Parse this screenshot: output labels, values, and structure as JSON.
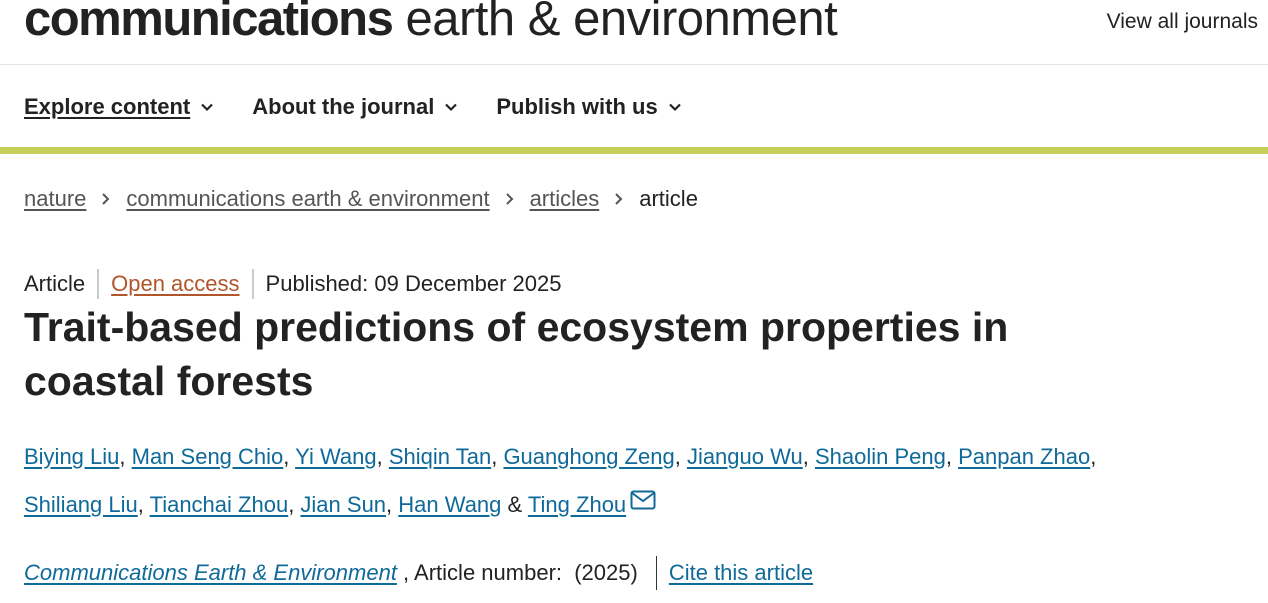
{
  "header": {
    "brand_bold": "communications",
    "brand_light": " earth & environment",
    "view_all": "View all journals"
  },
  "nav": {
    "items": [
      {
        "label": "Explore content"
      },
      {
        "label": "About the journal"
      },
      {
        "label": "Publish with us"
      }
    ]
  },
  "colors": {
    "accent_bar": "#c7cf5b",
    "link_blue": "#0f6a9a",
    "open_access": "#b1562b"
  },
  "breadcrumb": {
    "items": [
      "nature",
      "communications earth & environment",
      "articles"
    ],
    "current": "article"
  },
  "meta": {
    "type": "Article",
    "access": "Open access",
    "published": "Published: 09 December 2025"
  },
  "article": {
    "title": "Trait-based predictions of ecosystem properties in coastal forests"
  },
  "authors": {
    "names": [
      "Biying Liu",
      "Man Seng Chio",
      "Yi Wang",
      "Shiqin Tan",
      "Guanghong Zeng",
      "Jianguo Wu",
      "Shaolin Peng",
      "Panpan Zhao",
      "Shiliang Liu",
      "Tianchai Zhou",
      "Jian Sun",
      "Han Wang",
      "Ting Zhou"
    ],
    "separator": ", ",
    "last_separator": " & ",
    "corresponding_icon": "envelope-icon"
  },
  "citation": {
    "journal": "Communications Earth & Environment",
    "article_number_text": " , Article number:  (2025)",
    "cite_label": "Cite this article"
  }
}
